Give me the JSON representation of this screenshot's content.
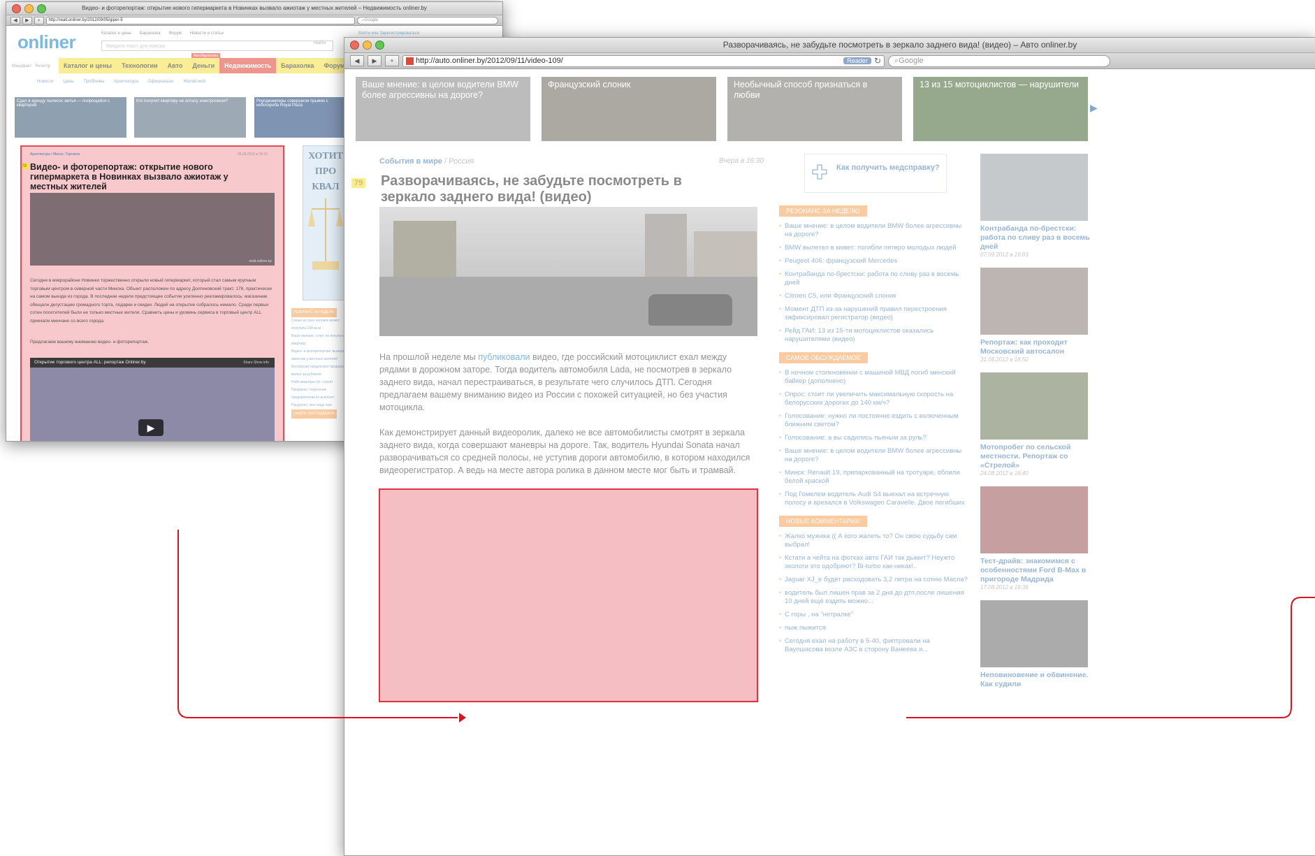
{
  "back_window": {
    "title": "Видео- и фоторепортаж: открытие нового гипермаркета в Новинках вызвало ажиотаж у местных жителей – Недвижимость onliner.by",
    "url": "http://realt.onliner.by/2012/09/05/giper-5",
    "search_placeholder": "Google",
    "logo": "onliner",
    "top_tabs": [
      "Каталог и цены",
      "Барахолка",
      "Форум",
      "Новости и статьи"
    ],
    "search_input_placeholder": "Введите текст для поиска",
    "search_button": "Найти",
    "login_links": "Войти или Зарегистрироваться",
    "small_links": [
      "Мануфакт",
      "Регистр"
    ],
    "menu": [
      "Каталог и цены",
      "Технологии",
      "Авто",
      "Деньги",
      "Недвижимость",
      "Барахолка",
      "Форум"
    ],
    "menu_active": "Недвижимость",
    "menu_badge": "Автобарахолка",
    "subnav": [
      "Новости",
      "Цены",
      "Проблемы",
      "Архитектура",
      "Официально",
      "Жилой мой"
    ],
    "teasers": [
      "Сдал в аренду пылесос житья — попрощайся с квартирой",
      "Кто получит квартиру не оплату электросвязи?",
      "Роупджамперы совершили прыжок с небоскреба Royal Plaza"
    ],
    "article": {
      "category": "Архитектура",
      "category_sub": "Минск, Торговля",
      "date": "05.09.2012 в 16:15",
      "count": "378",
      "title": "Видео- и фоторепортаж: открытие нового гипермаркета в Новинках вызвало ажиотаж у местных жителей",
      "photo_credit": "realt.onliner.by",
      "text": "Сегодня в микрорайоне Новинки торжественно открыли новый гипермаркет, который стал самым крупным торговым центром в северной части Минска. Объект расположен по адресу Долгиновский тракт, 178, практически на самом выезде из города. В последние недели предстоящее событие усиленно рекламировалось: магазинам обещали дегустацию громадного торта, подарки и скидки. Людей на открытие собралось немало. Среди первых сотен посетителей были не только местные жители. Сравнить цены и уровень сервиса в торговый центр ALL приехали минчане со всего города.",
      "text2": "Предлагаем вашему вниманию видео- и фоторепортаж.",
      "video_title": "Открытие торгового центра ALL: репортаж Onliner.by",
      "video_meta": "Share   Show info",
      "play": "▶"
    },
    "ad_text": "ХОТИТ ПРО КВАЛ",
    "side_heading": "РЕЗОНАНС ЗА НЕДЕЛЮ",
    "side_links": [
      "Семья из трех человек может получить 100 кв.м",
      "Ваше мнение: стоит ли покупать квартиру",
      "Видео- и фоторепортаж: вызвало ажиотаж у местных жителей",
      "Белорусам предлагают продавать жилье за рубежом",
      "Райо квартиры Gr: строят",
      "Продлено: поручение предприятиям по выплате",
      "Продлено: все чаще чем"
    ],
    "side_heading2": "САМОЕ ОБСУЖДАЕМОЕ"
  },
  "front_window": {
    "title": "Разворачиваясь, не забудьте посмотреть в зеркало заднего вида! (видео) – Авто onliner.by",
    "url": "http://auto.onliner.by/2012/09/11/video-109/",
    "reader": "Reader",
    "search_placeholder": "Google",
    "teasers": [
      {
        "title": "Ваше мнение: в целом водители BMW более агрессивны на дороге?",
        "color": "#8c8c8c"
      },
      {
        "title": "Французский слоник",
        "color": "#6f6b5f"
      },
      {
        "title": "Необычный способ признаться в любви",
        "color": "#7a7873"
      },
      {
        "title": "13 из 15 мотоциклистов — нарушители",
        "color": "#4b6a3a"
      }
    ],
    "article": {
      "category": "События в мире",
      "category_sub": "Россия",
      "date": "Вчера в 16:30",
      "count": "79",
      "title": "Разворачиваясь, не забудьте посмотреть в зеркало заднего вида! (видео)",
      "p1_before": "На прошлой неделе мы ",
      "p1_link": "публиковали",
      "p1_after": " видео, где российский мотоциклист ехал между рядами в дорожном заторе. Тогда водитель автомобиля Lada, не посмотрев в зеркало заднего вида, начал перестраиваться, в результате чего случилось ДТП. Сегодня предлагаем вашему вниманию видео из России с похожей ситуацией, но без участия мотоцикла.",
      "p2": "Как демонстрирует данный видеоролик, далеко не все автомобилисты смотрят в зеркала заднего вида, когда совершают маневры на дороге. Так, водитель Hyundai Sonata начал разворачиваться со средней полосы, не уступив дороги автомобилю, в котором находился видеорегистратор. А ведь на месте автора ролика в данном месте мог быть и трамвай."
    },
    "help_box": "Как получить медсправку?",
    "sections": [
      {
        "heading": "РЕЗОНАНС ЗА НЕДЕЛЮ",
        "items": [
          "Ваше мнение: в целом водители BMW более агрессивны на дороге?",
          "BMW вылетел в кювет: погибли пятеро молодых людей",
          "Peugeot 406: французский Mercedes",
          "Контрабанда по-брестски: работа по сливу раз в восемь дней",
          "Citroen C5, или Французский слоник",
          "Момент ДТП из-за нарушений правил перестроения зафиксировал регистратор (видео)",
          "Рейд ГАИ: 13 из 15-ти мотоциклистов оказались нарушителями (видео)"
        ]
      },
      {
        "heading": "САМОЕ ОБСУЖДАЕМОЕ",
        "items": [
          "В ночном столкновении с машиной МВД погиб минский байкер (дополнено)",
          "Опрос: стоит ли увеличить максимальную скорость на белорусских дорогах до 140 км/ч?",
          "Голосование: нужно ли постоянно ездить с включенным ближним светом?",
          "Голосование: а вы садились пьяным за руль?",
          "Ваше мнение: в целом водители BMW более агрессивны на дороге?",
          "Минск: Renault 19, припаркованный на тротуаре, облили белой краской",
          "Под Гомелем водитель Audi S4 выехал на встречную полосу и врезался в Volkswagen Caravelle. Двое погибших"
        ]
      },
      {
        "heading": "НОВЫЕ КОММЕНТАРИИ",
        "items": [
          "Жалко мужика (( А кого жалеть то? Он свою судьбу сам выбрал!",
          "Кстати а чейта на фотках авто ГАИ так дымит? Неужто экологи это одобряют? Bi-turbo как-никак!..",
          "Jaguar XJ_e будет расходовать 3,2 литра на сотню Масла?",
          "водитель был лишен прав за 2 дня до дтп,после лишения 10 дней ещё ездить можно...",
          "С горы , на \"нетралке\"",
          "пыж пыжится",
          "Сегодня ехал на работу в 5-40, фиптровали на Ваупшасова возле АЗС в сторону Ванеева и..."
        ]
      }
    ],
    "side_items": [
      {
        "caption": "Контрабанда по-брестски: работа по сливу раз в восемь дней",
        "date": "07.09.2012 в 19:03",
        "color": "#9aa1a6"
      },
      {
        "caption": "Репортаж: как проходит Московский автосалон",
        "date": "31.08.2012 в 18:50",
        "color": "#8b7f78"
      },
      {
        "caption": "Мотопробег по сельской местности. Репортаж со «Стрелой»",
        "date": "24.08.2012 в 18:40",
        "color": "#6f7b5c"
      },
      {
        "caption": "Тест-драйв: знакомимся с особенностями Ford B-Max в пригороде Мадрида",
        "date": "17.08.2012 в 18:36",
        "color": "#9c5a5a"
      },
      {
        "caption": "Неповиновение и обвинение. Как судили",
        "date": "",
        "color": "#6d6d6d"
      }
    ]
  },
  "colors": {
    "accent": "#1f84c8",
    "highlight": "#e0333f",
    "menu_yellow": "#f4e14a",
    "orange": "#f6a35b"
  }
}
